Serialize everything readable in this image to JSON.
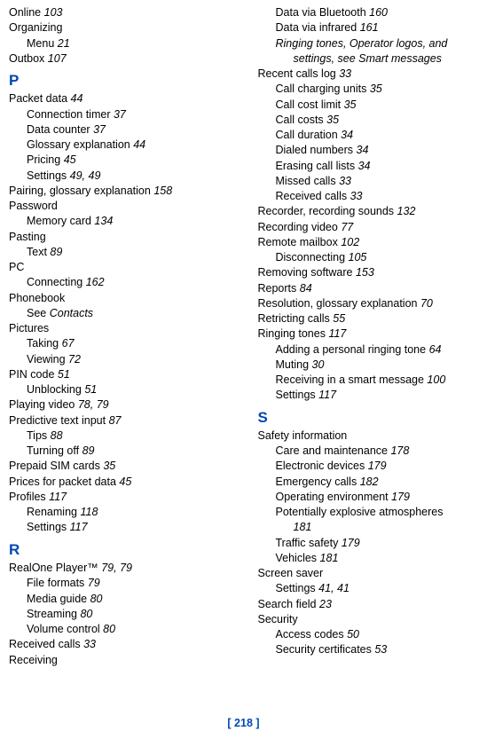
{
  "footer": "[ 218 ]",
  "letters": {
    "P": "P",
    "R": "R",
    "S": "S"
  },
  "left": {
    "online": {
      "t": "Online",
      "p": "103"
    },
    "organizing": {
      "t": "Organizing"
    },
    "organizing_menu": {
      "t": "Menu",
      "p": "21"
    },
    "outbox": {
      "t": "Outbox",
      "p": "107"
    },
    "packet": {
      "t": "Packet data",
      "p": "44"
    },
    "packet_ct": {
      "t": "Connection timer",
      "p": "37"
    },
    "packet_dc": {
      "t": "Data counter",
      "p": "37"
    },
    "packet_ge": {
      "t": "Glossary explanation",
      "p": "44"
    },
    "packet_pr": {
      "t": "Pricing",
      "p": "45"
    },
    "packet_se": {
      "t": "Settings",
      "p": "49, 49"
    },
    "pairing": {
      "t": "Pairing, glossary explanation",
      "p": "158"
    },
    "password": {
      "t": "Password"
    },
    "password_mc": {
      "t": "Memory card",
      "p": "134"
    },
    "pasting": {
      "t": "Pasting"
    },
    "pasting_txt": {
      "t": "Text",
      "p": "89"
    },
    "pc": {
      "t": "PC"
    },
    "pc_conn": {
      "t": "Connecting",
      "p": "162"
    },
    "phonebook": {
      "t": "Phonebook"
    },
    "phonebook_see": {
      "a": "See ",
      "b": "Contacts"
    },
    "pictures": {
      "t": "Pictures"
    },
    "pictures_tk": {
      "t": "Taking",
      "p": "67"
    },
    "pictures_vw": {
      "t": "Viewing",
      "p": "72"
    },
    "pin": {
      "t": "PIN code",
      "p": "51"
    },
    "pin_un": {
      "t": "Unblocking",
      "p": "51"
    },
    "playvid": {
      "t": "Playing video",
      "p": "78, 79"
    },
    "predtext": {
      "t": "Predictive text input",
      "p": "87"
    },
    "pred_tips": {
      "t": "Tips",
      "p": "88"
    },
    "pred_to": {
      "t": "Turning off",
      "p": "89"
    },
    "prepaid": {
      "t": "Prepaid SIM cards",
      "p": "35"
    },
    "prices": {
      "t": "Prices for packet data",
      "p": "45"
    },
    "profiles": {
      "t": "Profiles",
      "p": "117"
    },
    "prof_ren": {
      "t": "Renaming",
      "p": "118"
    },
    "prof_set": {
      "t": "Settings",
      "p": "117"
    },
    "realone": {
      "t": "RealOne Player™",
      "p": "79, 79"
    },
    "ro_ff": {
      "t": "File formats",
      "p": "79"
    },
    "ro_mg": {
      "t": "Media guide",
      "p": "80"
    },
    "ro_st": {
      "t": "Streaming",
      "p": "80"
    },
    "ro_vc": {
      "t": "Volume control",
      "p": "80"
    },
    "reccalls": {
      "t": "Received calls",
      "p": "33"
    },
    "receiving": {
      "t": "Receiving"
    }
  },
  "right": {
    "dvb": {
      "t": "Data via Bluetooth",
      "p": "160"
    },
    "dvi": {
      "t": "Data via infrared",
      "p": "161"
    },
    "rtol1": "Ringing tones, Operator logos, and",
    "rtol2": "settings, see Smart messages",
    "rcl": {
      "t": "Recent calls log",
      "p": "33"
    },
    "rcl_ccu": {
      "t": "Call charging units",
      "p": "35"
    },
    "rcl_ccl": {
      "t": "Call cost limit",
      "p": "35"
    },
    "rcl_cc": {
      "t": "Call costs",
      "p": "35"
    },
    "rcl_cd": {
      "t": "Call duration",
      "p": "34"
    },
    "rcl_dn": {
      "t": "Dialed numbers",
      "p": "34"
    },
    "rcl_ec": {
      "t": "Erasing call lists",
      "p": "34"
    },
    "rcl_mc": {
      "t": "Missed calls",
      "p": "33"
    },
    "rcl_rc": {
      "t": "Received calls",
      "p": "33"
    },
    "recorder": {
      "t": "Recorder, recording sounds",
      "p": "132"
    },
    "recvid": {
      "t": "Recording video",
      "p": "77"
    },
    "remmb": {
      "t": "Remote mailbox",
      "p": "102"
    },
    "remmb_dis": {
      "t": "Disconnecting",
      "p": "105"
    },
    "remsw": {
      "t": "Removing software",
      "p": "153"
    },
    "reports": {
      "t": "Reports",
      "p": "84"
    },
    "resol": {
      "t": "Resolution, glossary explanation",
      "p": "70"
    },
    "retr": {
      "t": "Retricting calls",
      "p": "55"
    },
    "ring": {
      "t": "Ringing tones",
      "p": "117"
    },
    "ring_add": {
      "t": "Adding a personal ringing tone",
      "p": "64"
    },
    "ring_mut": {
      "t": "Muting",
      "p": "30"
    },
    "ring_rec": {
      "t": "Receiving in a smart message",
      "p": "100"
    },
    "ring_set": {
      "t": "Settings",
      "p": "117"
    },
    "safety": {
      "t": "Safety information"
    },
    "saf_cm": {
      "t": "Care and maintenance",
      "p": "178"
    },
    "saf_ed": {
      "t": "Electronic devices",
      "p": "179"
    },
    "saf_ec": {
      "t": "Emergency calls",
      "p": "182"
    },
    "saf_oe": {
      "t": "Operating environment",
      "p": "179"
    },
    "saf_pea1": "Potentially explosive atmospheres",
    "saf_pea2": "181",
    "saf_ts": {
      "t": "Traffic safety",
      "p": "179"
    },
    "saf_vh": {
      "t": "Vehicles",
      "p": "181"
    },
    "scsaver": {
      "t": "Screen saver"
    },
    "scsaver_s": {
      "t": "Settings",
      "p": "41, 41"
    },
    "sfield": {
      "t": "Search field",
      "p": "23"
    },
    "security": {
      "t": "Security"
    },
    "sec_ac": {
      "t": "Access codes",
      "p": "50"
    },
    "sec_sc": {
      "t": "Security certificates",
      "p": "53"
    }
  }
}
